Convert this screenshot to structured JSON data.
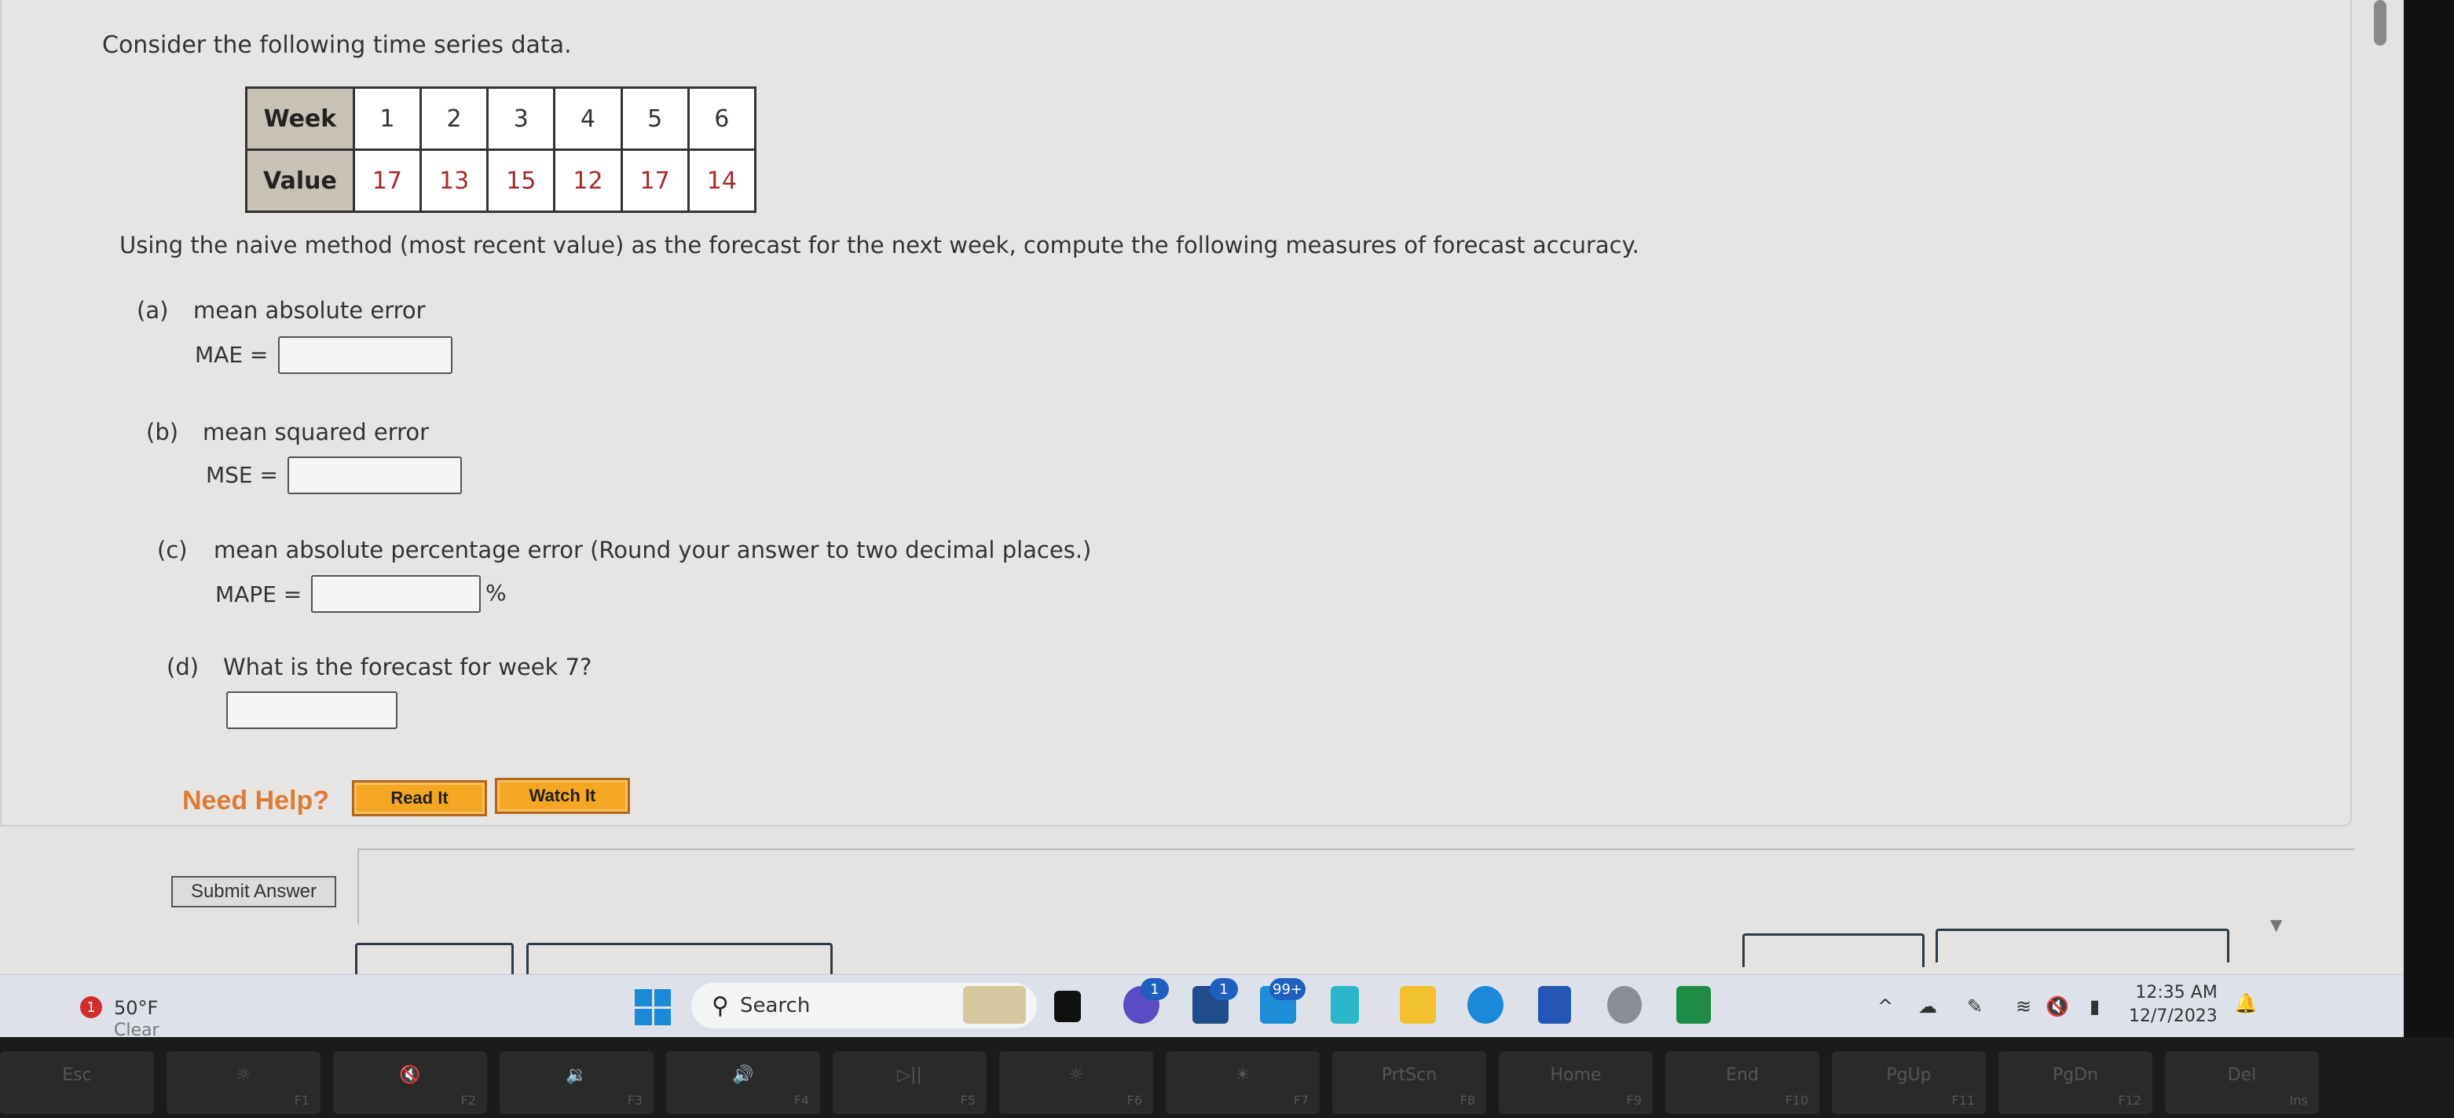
{
  "question": {
    "intro": "Consider the following time series data.",
    "table": {
      "row_headers": [
        "Week",
        "Value"
      ],
      "weeks": [
        "1",
        "2",
        "3",
        "4",
        "5",
        "6"
      ],
      "values": [
        "17",
        "13",
        "15",
        "12",
        "17",
        "14"
      ]
    },
    "prompt": "Using the naive method (most recent value) as the forecast for the next week, compute the following measures of forecast accuracy.",
    "parts": [
      {
        "label": "(a)",
        "text": "mean absolute error",
        "eq": "MAE =",
        "value": "",
        "suffix": ""
      },
      {
        "label": "(b)",
        "text": "mean squared error",
        "eq": "MSE =",
        "value": "",
        "suffix": ""
      },
      {
        "label": "(c)",
        "text": "mean absolute percentage error (Round your answer to two decimal places.)",
        "eq": "MAPE =",
        "value": "",
        "suffix": "%"
      },
      {
        "label": "(d)",
        "text": "What is the forecast for week 7?",
        "eq": "",
        "value": "",
        "suffix": ""
      }
    ],
    "help": {
      "label": "Need Help?",
      "read_it": "Read It",
      "watch_it": "Watch It"
    },
    "submit_label": "Submit Answer"
  },
  "taskbar": {
    "weather": {
      "badge": "1",
      "temp": "50°F",
      "condition": "Clear"
    },
    "search_label": "Search",
    "apps": [
      {
        "name": "widgets-icon",
        "badge": ""
      },
      {
        "name": "task-view-icon",
        "badge": ""
      },
      {
        "name": "teams-meet-icon",
        "badge": "1"
      },
      {
        "name": "microsoft-store-icon",
        "badge": "1"
      },
      {
        "name": "mail-icon",
        "badge": "99+"
      },
      {
        "name": "notepad-icon",
        "badge": ""
      },
      {
        "name": "file-explorer-icon",
        "badge": ""
      },
      {
        "name": "edge-icon",
        "badge": ""
      },
      {
        "name": "word-icon",
        "badge": ""
      },
      {
        "name": "settings-icon",
        "badge": ""
      },
      {
        "name": "excel-icon",
        "badge": ""
      }
    ],
    "tray": {
      "chevron": "^",
      "time": "12:35 AM",
      "date": "12/7/2023"
    }
  },
  "keyboard": {
    "keys": [
      {
        "main": "Esc",
        "fn": ""
      },
      {
        "main": "☼",
        "fn": "F1"
      },
      {
        "main": "🔇",
        "fn": "F2"
      },
      {
        "main": "🔉",
        "fn": "F3"
      },
      {
        "main": "🔊",
        "fn": "F4"
      },
      {
        "main": "▷||",
        "fn": "F5"
      },
      {
        "main": "☼",
        "fn": "F6"
      },
      {
        "main": "☀",
        "fn": "F7"
      },
      {
        "main": "PrtScn",
        "fn": "F8"
      },
      {
        "main": "Home",
        "fn": "F9"
      },
      {
        "main": "End",
        "fn": "F10"
      },
      {
        "main": "PgUp",
        "fn": "F11"
      },
      {
        "main": "PgDn",
        "fn": "F12"
      },
      {
        "main": "Del",
        "fn": "Ins"
      }
    ]
  }
}
